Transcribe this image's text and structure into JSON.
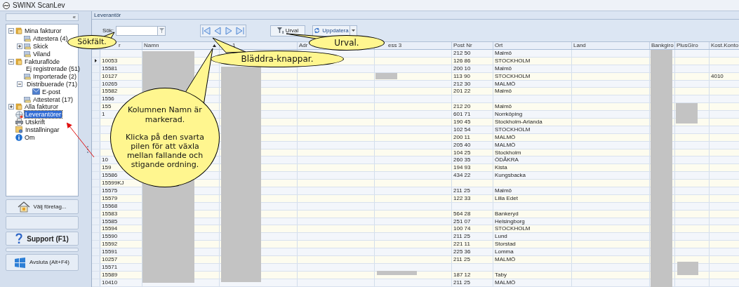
{
  "window": {
    "title": "SWINX ScanLev"
  },
  "sidebar": {
    "collapse_glyph": "«",
    "tree": [
      {
        "label": "Mina fakturor",
        "kind": "folder",
        "expanded": true,
        "selected": false,
        "children": [
          {
            "label": "Attestera (4)",
            "kind": "document",
            "selected": false
          },
          {
            "label": "Skick",
            "kind": "document",
            "expanded": false,
            "selected": false
          },
          {
            "label": "Viland",
            "kind": "document",
            "selected": false
          }
        ]
      },
      {
        "label": "Fakturaflöde",
        "kind": "folder",
        "expanded": true,
        "selected": false,
        "children": [
          {
            "label": "Ej registrerade (51)",
            "kind": "document",
            "selected": false
          },
          {
            "label": "Importerade (2)",
            "kind": "document",
            "selected": false
          },
          {
            "label": "Distribuerade (71)",
            "kind": "document",
            "expanded": true,
            "selected": false,
            "children": [
              {
                "label": "E-post",
                "kind": "mail",
                "selected": false
              }
            ]
          },
          {
            "label": "Attesterat (17)",
            "kind": "document",
            "selected": false
          }
        ]
      },
      {
        "label": "Alla fakturor",
        "kind": "folder",
        "expanded": false,
        "selected": false
      },
      {
        "label": "Leverantörer",
        "kind": "globe",
        "selected": true
      },
      {
        "label": "Utskrift",
        "kind": "printer",
        "selected": false
      },
      {
        "label": "Inställningar",
        "kind": "settings",
        "selected": false
      },
      {
        "label": "Om",
        "kind": "info",
        "selected": false
      }
    ],
    "buttons": [
      {
        "kind": "company",
        "label": "Välj företag..."
      },
      {
        "kind": "blank"
      },
      {
        "kind": "support",
        "label": "Support (F1)"
      },
      {
        "kind": "spacer"
      },
      {
        "kind": "exit",
        "label": "Avsluta (Alt+F4)"
      }
    ]
  },
  "panel": {
    "title": "Leverantör"
  },
  "toolbar": {
    "search": {
      "label": "Sök:"
    },
    "urval": {
      "label": "Urval"
    },
    "uppdatera": {
      "label": "Uppdatera"
    }
  },
  "table": {
    "columns": [
      {
        "label": "r"
      },
      {
        "label": "Namn",
        "sorted": true
      },
      {
        "label": "1"
      },
      {
        "label": "Adr"
      },
      {
        "label": "ess 3"
      },
      {
        "label": "Post Nr"
      },
      {
        "label": "Ort"
      },
      {
        "label": "Land"
      },
      {
        "label": "Bankgiro"
      },
      {
        "label": "PlusGiro"
      },
      {
        "label": "Kost.Konto"
      }
    ],
    "rows": [
      {
        "selected": false,
        "post_nr": "212 50",
        "ort": "Malmö"
      },
      {
        "selected": true,
        "id": "10053",
        "post_nr": "126 86",
        "ort": "STOCKHOLM"
      },
      {
        "selected": false,
        "id": "15581",
        "post_nr": "200 10",
        "ort": "Malmö"
      },
      {
        "selected": false,
        "id": "10127",
        "post_nr": "113 90",
        "ort": "STOCKHOLM",
        "kost_konto": "4010"
      },
      {
        "selected": false,
        "id": "10265",
        "post_nr": "212 30",
        "ort": "MALMÖ"
      },
      {
        "selected": false,
        "id": "15582",
        "post_nr": "201 22",
        "ort": "Malmö"
      },
      {
        "selected": false,
        "id": "1556"
      },
      {
        "selected": false,
        "id": "155",
        "post_nr": "212 20",
        "ort": "Malmö"
      },
      {
        "selected": false,
        "id": "1",
        "post_nr": "601 71",
        "ort": "Norrköping"
      },
      {
        "selected": false,
        "post_nr": "190 45",
        "ort": "Stockholm-Arlanda"
      },
      {
        "selected": false,
        "post_nr": "102 54",
        "ort": "STOCKHOLM"
      },
      {
        "selected": false,
        "post_nr": "200 11",
        "ort": "MALMÖ"
      },
      {
        "selected": false,
        "post_nr": "205 40",
        "ort": "MALMÖ"
      },
      {
        "selected": false,
        "post_nr": "104 25",
        "ort": "Stockholm"
      },
      {
        "selected": false,
        "id": "10",
        "post_nr": "260 35",
        "ort": "ÖDÅKRA"
      },
      {
        "selected": false,
        "id": "159",
        "post_nr": "194 93",
        "ort": "Kista"
      },
      {
        "selected": false,
        "id": "15586",
        "post_nr": "434 22",
        "ort": "Kungsbacka"
      },
      {
        "selected": false,
        "id": "15599KJ"
      },
      {
        "selected": false,
        "id": "15575",
        "post_nr": "211 25",
        "ort": "Malmö"
      },
      {
        "selected": false,
        "id": "15579",
        "post_nr": "122 33",
        "ort": "Lilla Edet"
      },
      {
        "selected": false,
        "id": "15568"
      },
      {
        "selected": false,
        "id": "15583",
        "post_nr": "564 28",
        "ort": "Bankeryd"
      },
      {
        "selected": false,
        "id": "15585",
        "post_nr": "251 07",
        "ort": "Helsingborg"
      },
      {
        "selected": false,
        "id": "15594",
        "post_nr": "100 74",
        "ort": "STOCKHOLM"
      },
      {
        "selected": false,
        "id": "15590",
        "post_nr": "211 25",
        "ort": "Lund"
      },
      {
        "selected": false,
        "id": "15592",
        "post_nr": "221 11",
        "ort": "Storstad"
      },
      {
        "selected": false,
        "id": "15591",
        "post_nr": "225 36",
        "ort": "Lomma"
      },
      {
        "selected": false,
        "id": "10257",
        "post_nr": "211 25",
        "ort": "MALMÖ"
      },
      {
        "selected": false,
        "id": "15571"
      },
      {
        "selected": false,
        "id": "15589",
        "post_nr": "187 12",
        "ort": "Taby"
      },
      {
        "selected": false,
        "id": "10410",
        "post_nr": "211 25",
        "ort": "MALMÖ"
      }
    ]
  },
  "callouts": [
    {
      "text": "Sökfält."
    },
    {
      "text": "Urval."
    },
    {
      "text": "Bläddra-knappar."
    },
    {
      "paragraphs": [
        "Kolumnen Namn är markerad.",
        "Klicka på den svarta pilen för att växla mellan fallande och stigande ordning."
      ]
    }
  ]
}
